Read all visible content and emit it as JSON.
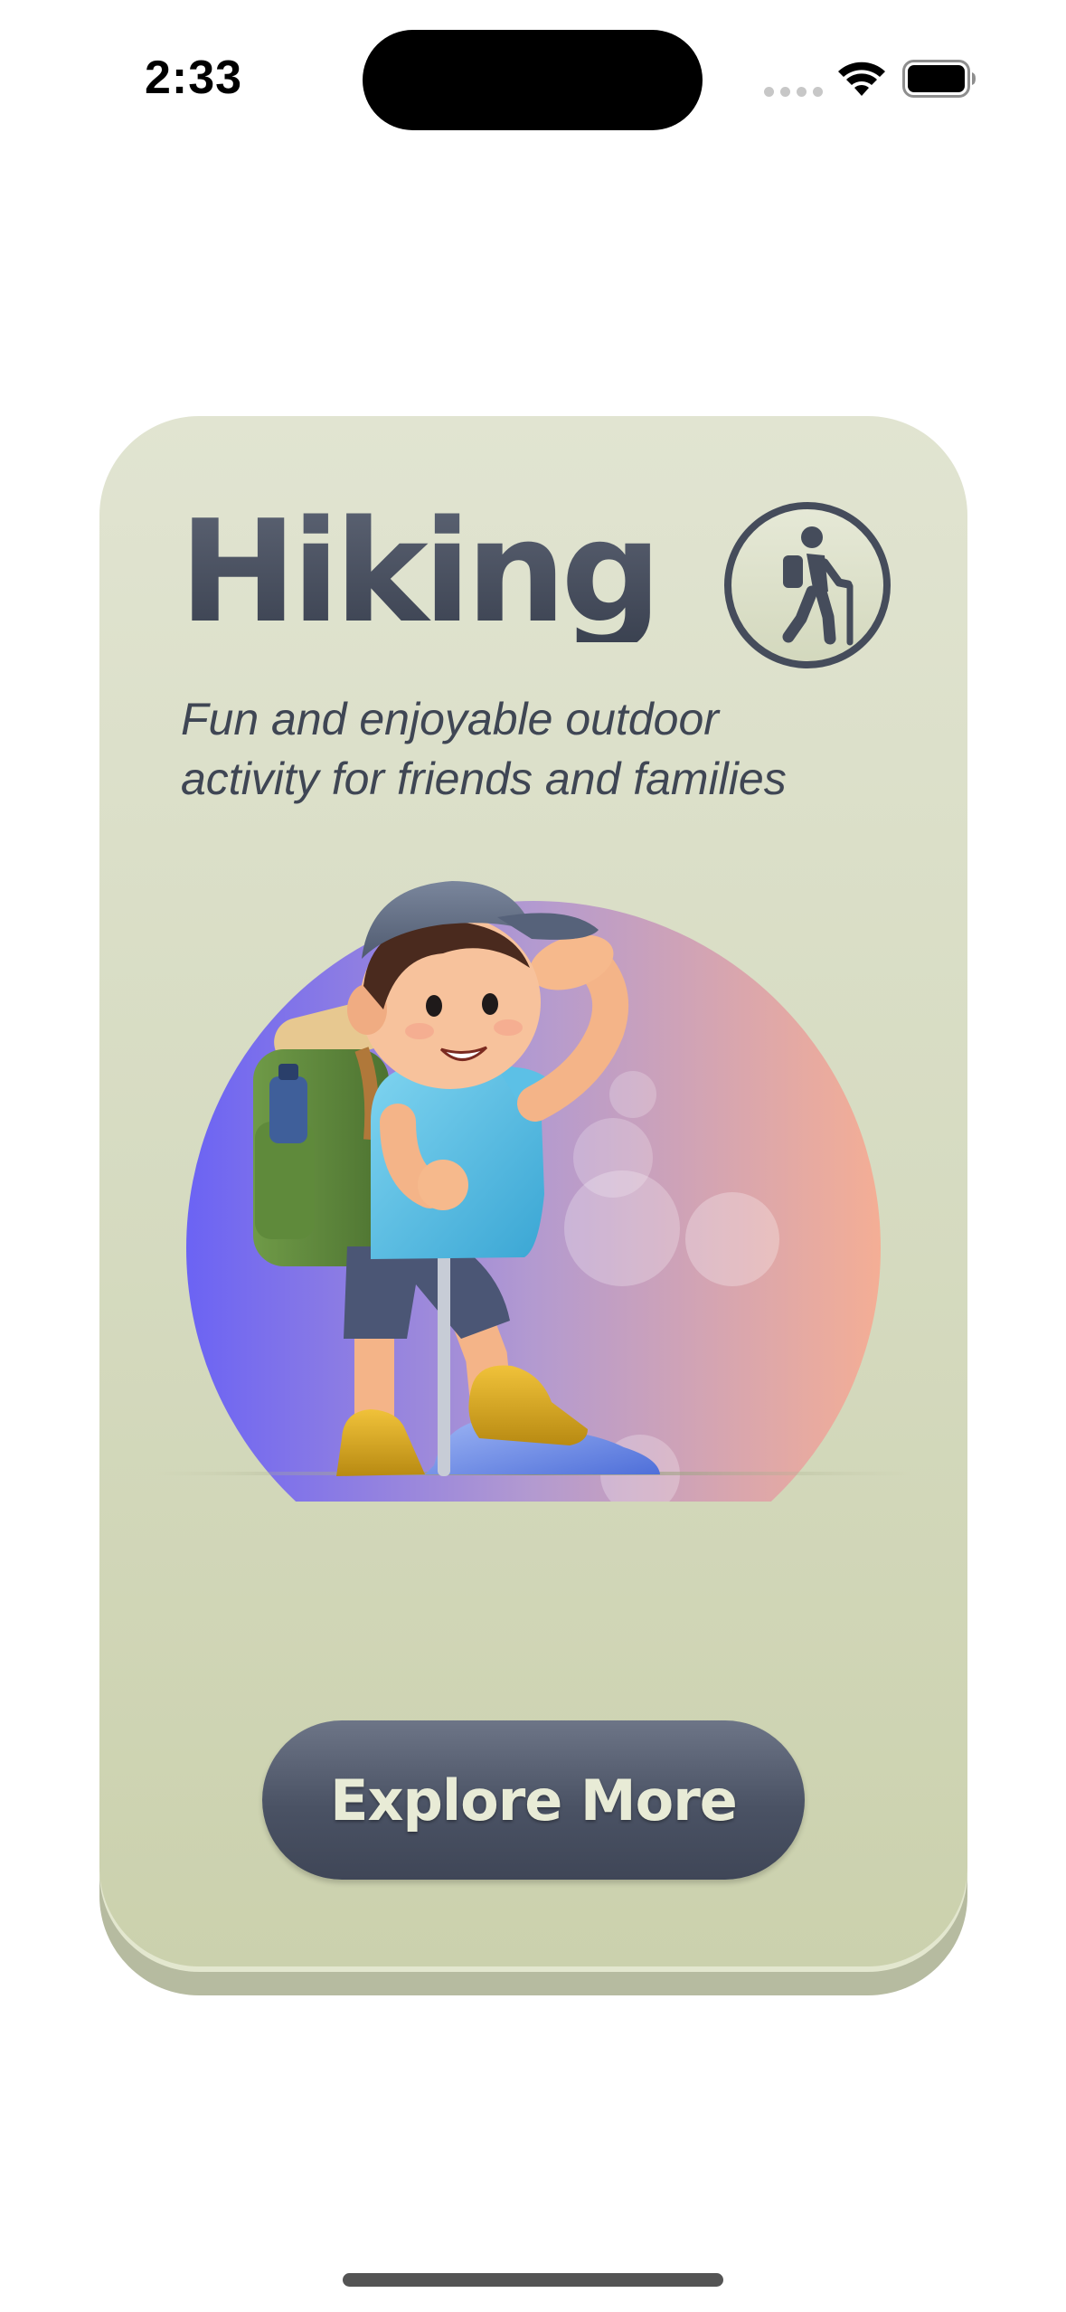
{
  "status_bar": {
    "time": "2:33",
    "icons": [
      "cellular-signal-icon",
      "wifi-icon",
      "battery-icon"
    ]
  },
  "card": {
    "title": "Hiking",
    "subtitle": "Fun and enjoyable outdoor activity for friends and families",
    "badge_icon": "hiker-icon",
    "illustration": "hiker-boy-illustration",
    "button_label": "Explore More"
  },
  "colors": {
    "card_top": "#e1e4d1",
    "card_bottom": "#cbd1ad",
    "button": "#4a5264",
    "button_text": "#e8ebd6",
    "title": "#4d5463",
    "circle_gradient_left": "#6b63f4",
    "circle_gradient_right": "#f4ae95"
  }
}
